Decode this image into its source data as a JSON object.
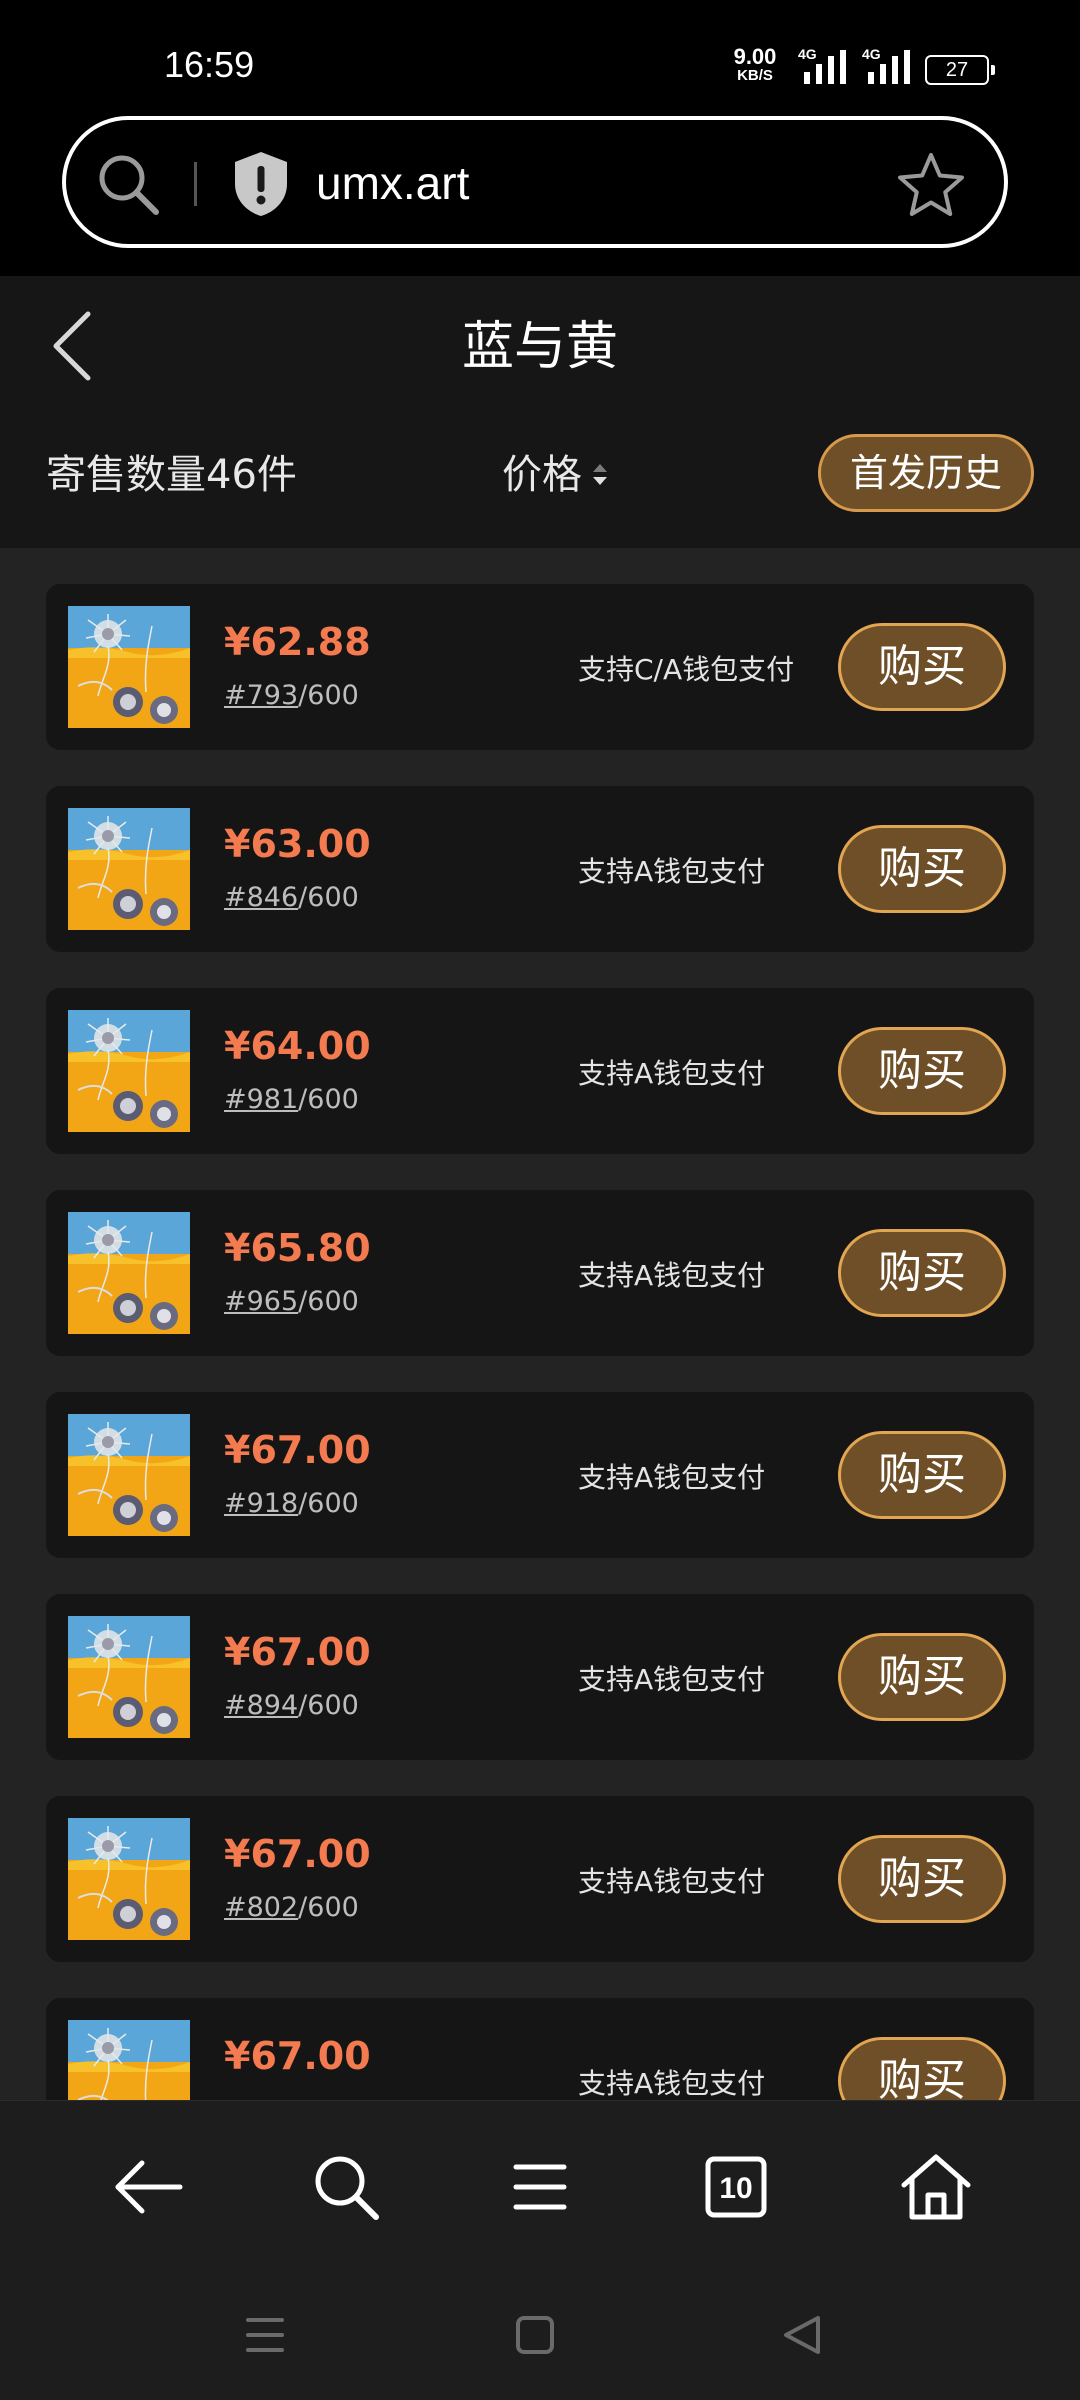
{
  "status_bar": {
    "time": "16:59",
    "net_speed_value": "9.00",
    "net_speed_unit": "KB/S",
    "signal1_label": "4G",
    "signal2_label": "4G",
    "battery": "27"
  },
  "browser": {
    "url": "umx.art",
    "tab_count": "10"
  },
  "header": {
    "title": "蓝与黄",
    "consign_count": "寄售数量46件",
    "sort_label": "价格",
    "history_button": "首发历史"
  },
  "listings": [
    {
      "price": "¥62.88",
      "number": "#793",
      "total": "/600",
      "payment": "支持C/A钱包支付",
      "buy": "购买"
    },
    {
      "price": "¥63.00",
      "number": "#846",
      "total": "/600",
      "payment": "支持A钱包支付",
      "buy": "购买"
    },
    {
      "price": "¥64.00",
      "number": "#981",
      "total": "/600",
      "payment": "支持A钱包支付",
      "buy": "购买"
    },
    {
      "price": "¥65.80",
      "number": "#965",
      "total": "/600",
      "payment": "支持A钱包支付",
      "buy": "购买"
    },
    {
      "price": "¥67.00",
      "number": "#918",
      "total": "/600",
      "payment": "支持A钱包支付",
      "buy": "购买"
    },
    {
      "price": "¥67.00",
      "number": "#894",
      "total": "/600",
      "payment": "支持A钱包支付",
      "buy": "购买"
    },
    {
      "price": "¥67.00",
      "number": "#802",
      "total": "/600",
      "payment": "支持A钱包支付",
      "buy": "购买"
    },
    {
      "price": "¥67.00",
      "number": "",
      "total": "",
      "payment": "支持A钱包支付",
      "buy": "购买"
    }
  ],
  "colors": {
    "price": "#f47a4f",
    "button_fill": "#6f4f27",
    "button_border": "#e2a552",
    "card_bg": "#151515",
    "page_bg": "#232323"
  },
  "icons": {
    "url_bar": [
      "search-icon",
      "shield-alert-icon",
      "star-icon"
    ],
    "bottom_nav": [
      "back-arrow-icon",
      "search-icon",
      "menu-icon",
      "tabs-icon",
      "home-icon"
    ],
    "system_nav": [
      "recent-apps-icon",
      "home-square-icon",
      "back-triangle-icon"
    ]
  }
}
